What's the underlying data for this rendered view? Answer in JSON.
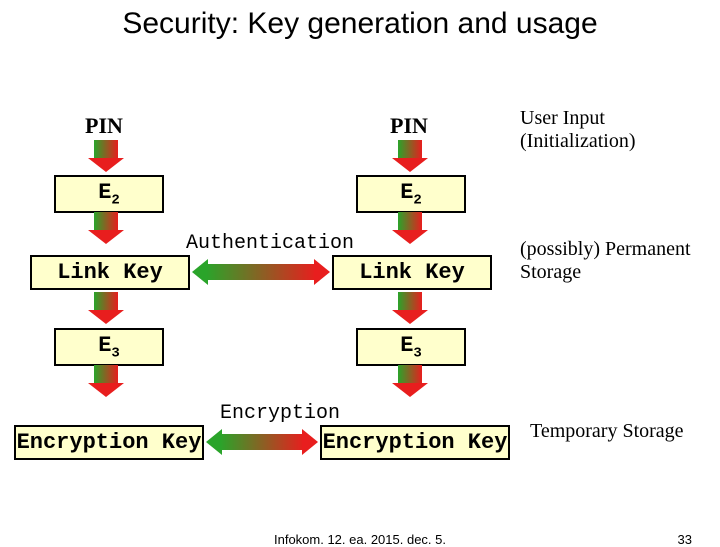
{
  "title": "Security: Key generation and usage",
  "left": {
    "pin": "PIN",
    "e2": "E",
    "e2_sub": "2",
    "linkkey": "Link Key",
    "e3": "E",
    "e3_sub": "3",
    "enckey": "Encryption Key"
  },
  "right": {
    "pin": "PIN",
    "e2": "E",
    "e2_sub": "2",
    "linkkey": "Link Key",
    "e3": "E",
    "e3_sub": "3",
    "enckey": "Encryption Key"
  },
  "mid": {
    "auth": "Authentication",
    "enc": "Encryption"
  },
  "annot": {
    "userinput": "User Input (Initialization)",
    "permstore": "(possibly) Permanent Storage",
    "tempstore": "Temporary Storage"
  },
  "footer": {
    "text": "Infokom. 12. ea. 2015. dec. 5.",
    "page": "33"
  }
}
